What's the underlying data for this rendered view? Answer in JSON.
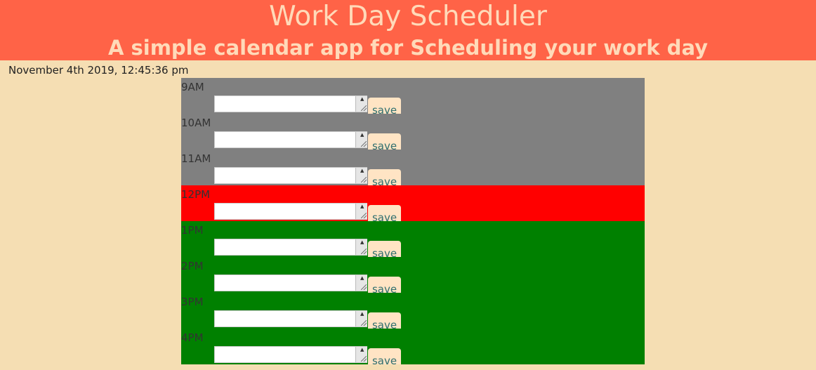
{
  "header": {
    "title": "Work Day Scheduler",
    "subtitle": "A simple calendar app for Scheduling your work day"
  },
  "datetime": "November 4th 2019, 12:45:36 pm",
  "colors": {
    "header_bg": "#FF6347",
    "header_text": "#FFDAB9",
    "page_bg": "#F5DEB3",
    "past": "#808080",
    "present": "#FF0000",
    "future": "#008000",
    "save_bg": "#FFE4C4",
    "save_text": "#2F6F6F"
  },
  "schedule": {
    "hours": [
      {
        "label": "9AM",
        "state": "past",
        "value": "",
        "save_label": "save"
      },
      {
        "label": "10AM",
        "state": "past",
        "value": "",
        "save_label": "save"
      },
      {
        "label": "11AM",
        "state": "past",
        "value": "",
        "save_label": "save"
      },
      {
        "label": "12PM",
        "state": "present",
        "value": "",
        "save_label": "save"
      },
      {
        "label": "1PM",
        "state": "future",
        "value": "",
        "save_label": "save"
      },
      {
        "label": "2PM",
        "state": "future",
        "value": "",
        "save_label": "save"
      },
      {
        "label": "3PM",
        "state": "future",
        "value": "",
        "save_label": "save"
      },
      {
        "label": "4PM",
        "state": "future",
        "value": "",
        "save_label": "save"
      }
    ]
  }
}
